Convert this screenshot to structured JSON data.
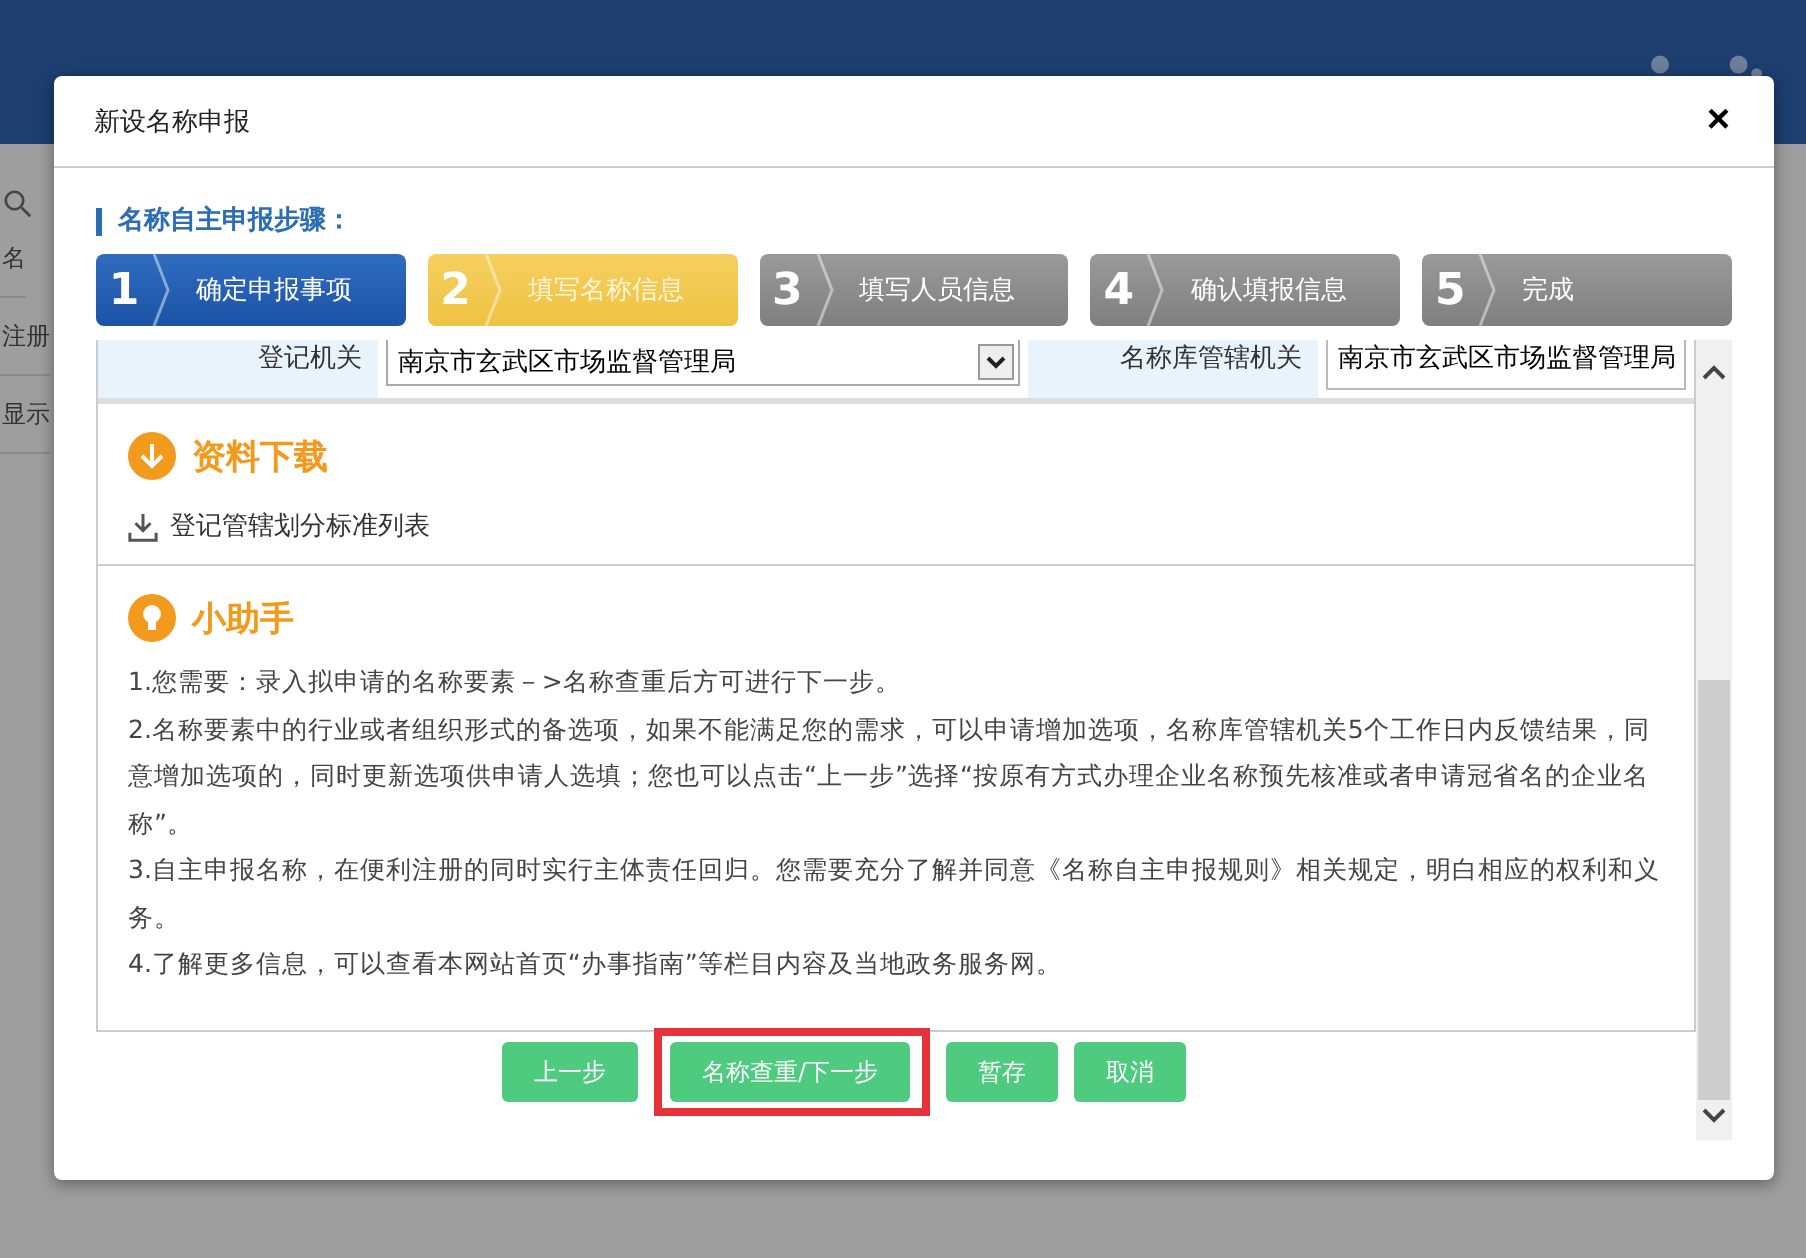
{
  "page": {
    "left_fragments": [
      "名",
      "注册",
      "显示"
    ]
  },
  "dialog": {
    "title": "新设名称申报",
    "close": "×"
  },
  "steps_heading": "名称自主申报步骤：",
  "steps": [
    {
      "number": "1",
      "label": "确定申报事项",
      "kind": "done"
    },
    {
      "number": "2",
      "label": "填写名称信息",
      "kind": "current"
    },
    {
      "number": "3",
      "label": "填写人员信息",
      "kind": "todo"
    },
    {
      "number": "4",
      "label": "确认填报信息",
      "kind": "todo"
    },
    {
      "number": "5",
      "label": "完成",
      "kind": "todo"
    }
  ],
  "form_row": {
    "registry_label": "登记机关",
    "registry_value": "南京市玄武区市场监督管理局",
    "library_label": "名称库管辖机关",
    "library_value": "南京市玄武区市场监督管理局"
  },
  "downloads": {
    "heading": "资料下载",
    "items": [
      "登记管辖划分标准列表"
    ]
  },
  "helper": {
    "heading": "小助手",
    "paragraphs": [
      "1.您需要：录入拟申请的名称要素－>名称查重后方可进行下一步。",
      "2.名称要素中的行业或者组织形式的备选项，如果不能满足您的需求，可以申请增加选项，名称库管辖机关5个工作日内反馈结果，同意增加选项的，同时更新选项供申请人选填；您也可以点击“上一步”选择“按原有方式办理企业名称预先核准或者申请冠省名的企业名称”。",
      "3.自主申报名称，在便利注册的同时实行主体责任回归。您需要充分了解并同意《名称自主申报规则》相关规定，明白相应的权利和义务。",
      "4.了解更多信息，可以查看本网站首页“办事指南”等栏目内容及当地政务服务网。"
    ]
  },
  "buttons": [
    {
      "label": "上一步",
      "highlighted": false
    },
    {
      "label": "名称查重/下一步",
      "highlighted": true
    },
    {
      "label": "暂存",
      "highlighted": false
    },
    {
      "label": "取消",
      "highlighted": false
    }
  ]
}
